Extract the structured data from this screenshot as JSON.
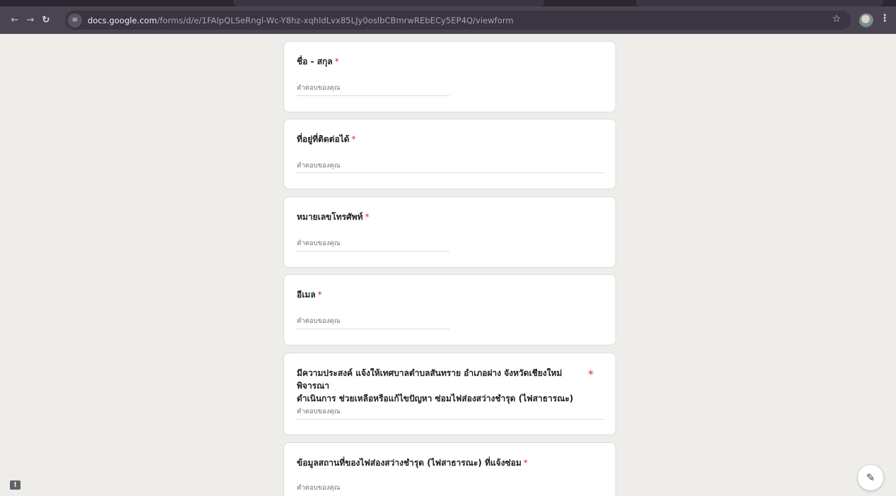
{
  "browser": {
    "url_host": "docs.google.com",
    "url_path": "/forms/d/e/1FAIpQLSeRngl-Wc-Y8hz-xqhldLvx85LJy0oslbCBmrwREbECy5EP4Q/viewform"
  },
  "form": {
    "required_mark": "*",
    "questions": [
      {
        "title": "ชื่อ - สกุล",
        "placeholder": "คำตอบของคุณ"
      },
      {
        "title": "ที่อยู่ที่ติดต่อได้",
        "placeholder": "คำตอบของคุณ"
      },
      {
        "title": "หมายเลขโทรศัพท์",
        "placeholder": "คำตอบของคุณ"
      },
      {
        "title": "อีเมล",
        "placeholder": "คำตอบของคุณ"
      },
      {
        "title_line1": "มีความประสงค์ แจ้งให้เทศบาลตำบลสันทราย อำเภอฝาง จังหวัดเชียงใหม่ พิจารณา",
        "title_line2": "ดำเนินการ ช่วยเหลือหรือแก้ไขปัญหา ซ่อมไฟส่องสว่างชำรุด (ไฟสาธารณะ)",
        "placeholder": "คำตอบของคุณ"
      },
      {
        "title": "ข้อมูลสถานที่ของไฟส่องสว่างชำรุด (ไฟสาธารณะ) ที่แจ้งซ่อม",
        "placeholder": "คำตอบของคุณ"
      }
    ]
  },
  "icons": {
    "back": "back-arrow-icon",
    "forward": "forward-arrow-icon",
    "reload": "reload-icon",
    "site_info": "tune-icon",
    "star": "star-icon",
    "menu": "kebab-menu-icon",
    "report": "report-icon",
    "edit": "pencil-icon"
  }
}
